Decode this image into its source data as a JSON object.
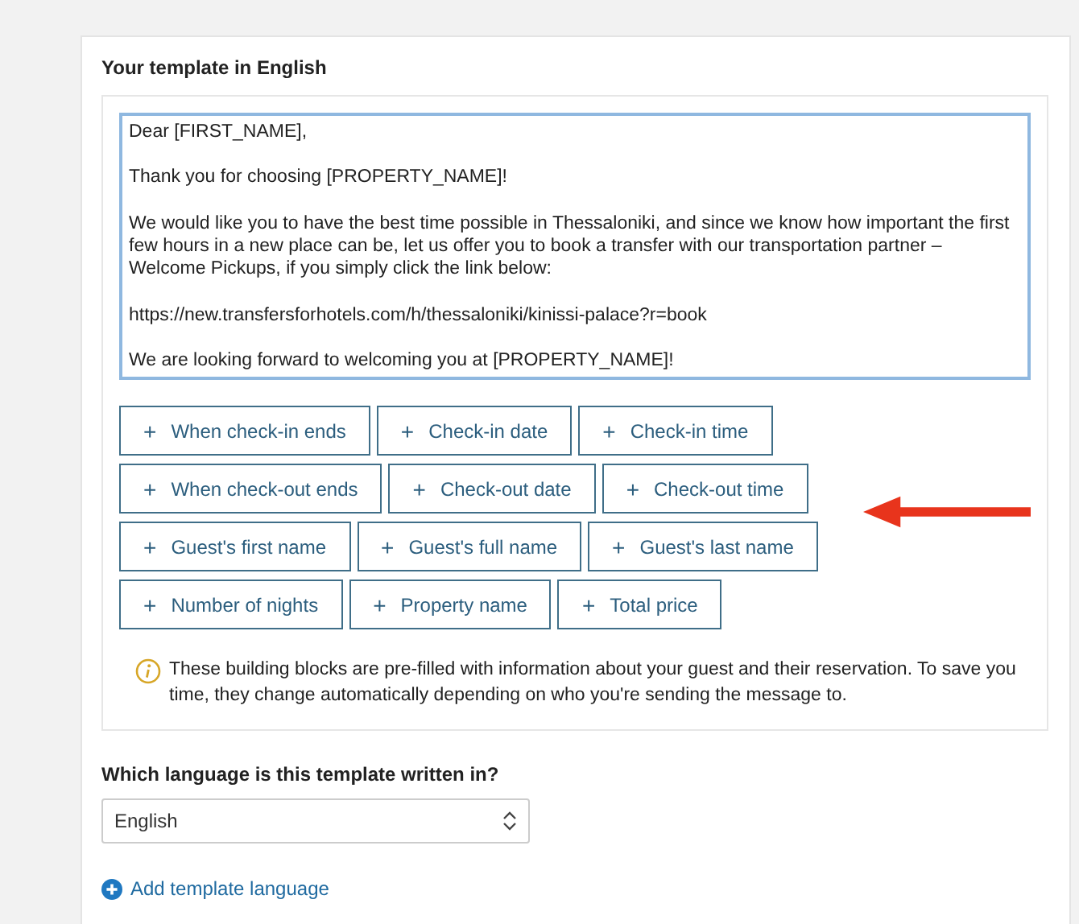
{
  "template_section": {
    "title": "Your template in English",
    "message": "Dear [FIRST_NAME],\n\nThank you for choosing [PROPERTY_NAME]!\n\nWe would like you to have the best time possible in Thessaloniki, and since we know how important the first few hours in a new place can be, let us offer you to book a transfer with our transportation partner – Welcome Pickups, if you simply click the link below:\n\nhttps://new.transfersforhotels.com/h/thessaloniki/kinissi-palace?r=book\n\nWe are looking forward to welcoming you at [PROPERTY_NAME]!",
    "block_rows": [
      [
        "When check-in ends",
        "Check-in date",
        "Check-in time"
      ],
      [
        "When check-out ends",
        "Check-out date",
        "Check-out time"
      ],
      [
        "Guest's first name",
        "Guest's full name",
        "Guest's last name"
      ],
      [
        "Number of nights",
        "Property name",
        "Total price"
      ]
    ],
    "button_prefix": "+",
    "info": "These building blocks are pre-filled with information about your guest and their reservation. To save you time, they change automatically depending on who you're sending the message to."
  },
  "language": {
    "label": "Which language is this template written in?",
    "value": "English"
  },
  "add_language_link": "Add template language"
}
